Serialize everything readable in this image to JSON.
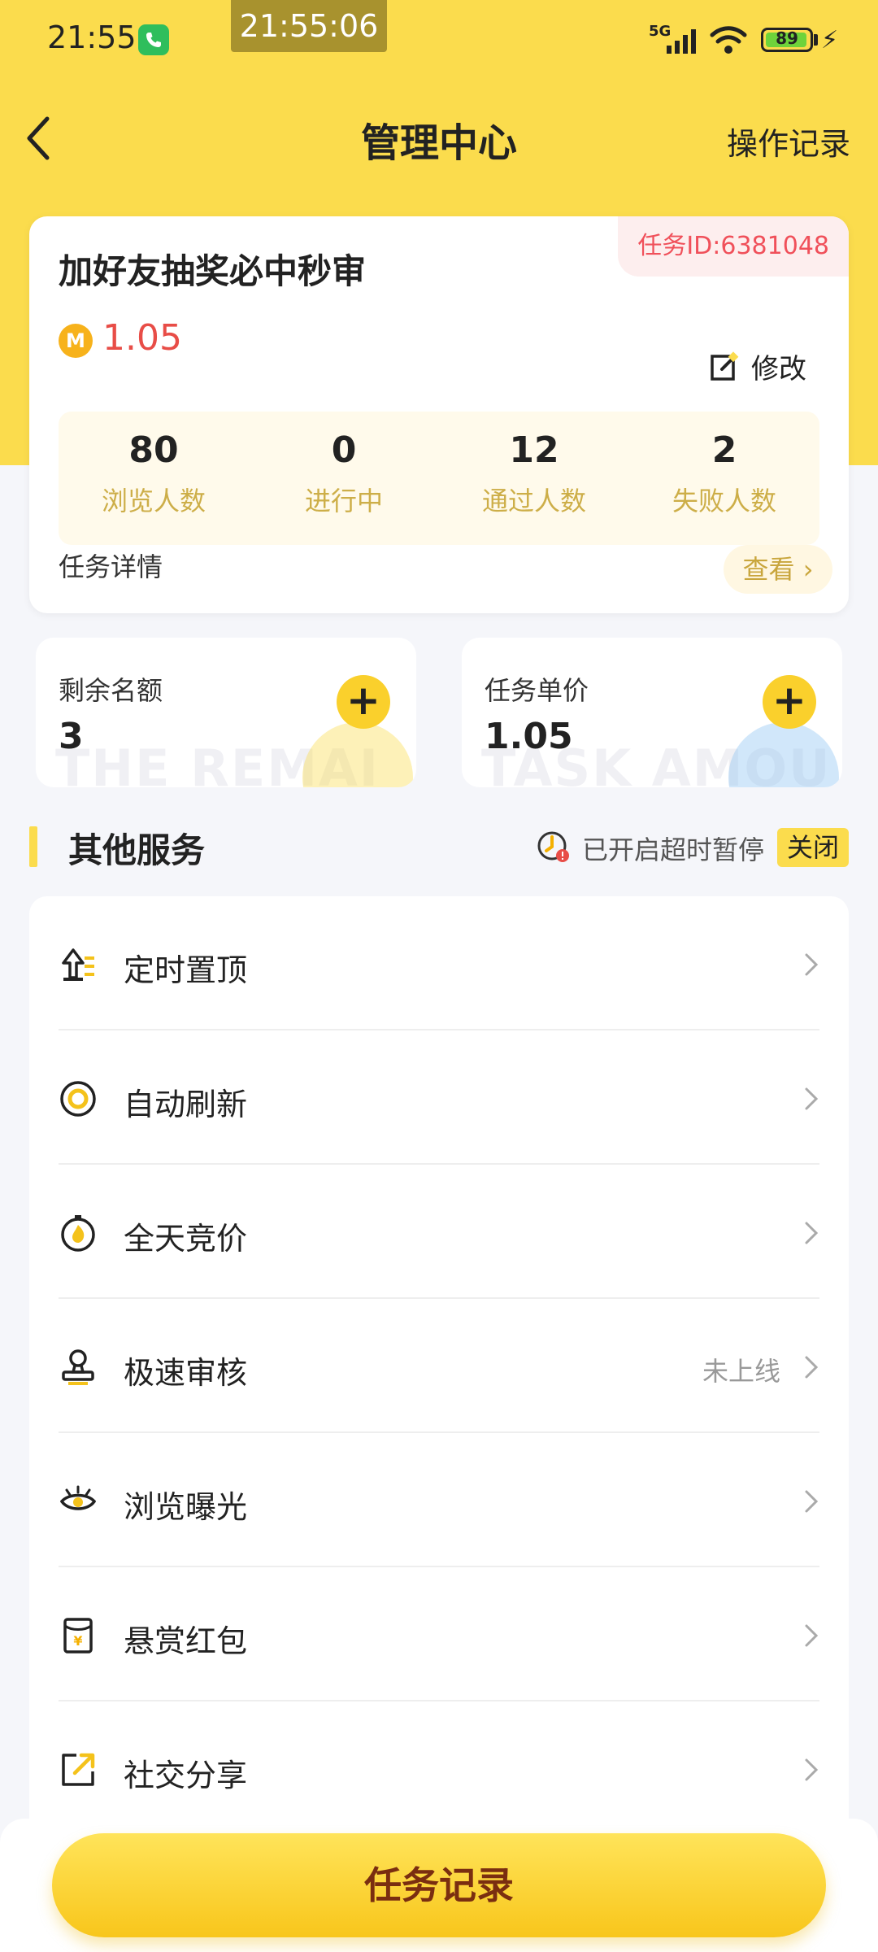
{
  "status_bar": {
    "time": "21:55",
    "overlay_time": "21:55:06",
    "network": "5G",
    "battery": "89"
  },
  "header": {
    "title": "管理中心",
    "right_action": "操作记录"
  },
  "task_card": {
    "title": "加好友抽奖必中秒审",
    "task_id": "任务ID:6381048",
    "coin_glyph": "M",
    "price": "1.05",
    "edit_label": "修改",
    "stats": [
      {
        "value": "80",
        "label": "浏览人数"
      },
      {
        "value": "0",
        "label": "进行中"
      },
      {
        "value": "12",
        "label": "通过人数"
      },
      {
        "value": "2",
        "label": "失败人数"
      }
    ],
    "detail_label": "任务详情",
    "view_label": "查看"
  },
  "mini_cards": {
    "remaining": {
      "label": "剩余名额",
      "value": "3",
      "watermark": "THE REMAI"
    },
    "unit_price": {
      "label": "任务单价",
      "value": "1.05",
      "watermark": "TASK AMOU"
    }
  },
  "other_services": {
    "title": "其他服务",
    "timeout_text": "已开启超时暂停",
    "close_label": "关闭",
    "items": [
      {
        "label": "定时置顶",
        "icon": "pin-top-icon",
        "extra": ""
      },
      {
        "label": "自动刷新",
        "icon": "refresh-icon",
        "extra": ""
      },
      {
        "label": "全天竞价",
        "icon": "bid-icon",
        "extra": ""
      },
      {
        "label": "极速审核",
        "icon": "stamp-icon",
        "extra": "未上线"
      },
      {
        "label": "浏览曝光",
        "icon": "eye-icon",
        "extra": ""
      },
      {
        "label": "悬赏红包",
        "icon": "red-packet-icon",
        "extra": ""
      },
      {
        "label": "社交分享",
        "icon": "share-icon",
        "extra": ""
      }
    ]
  },
  "bottom": {
    "button_label": "任务记录"
  },
  "colors": {
    "brand_yellow": "#FBDC4D",
    "price_red": "#E84D47",
    "label_gold": "#CDAE48",
    "button_text": "#7A2E10"
  }
}
